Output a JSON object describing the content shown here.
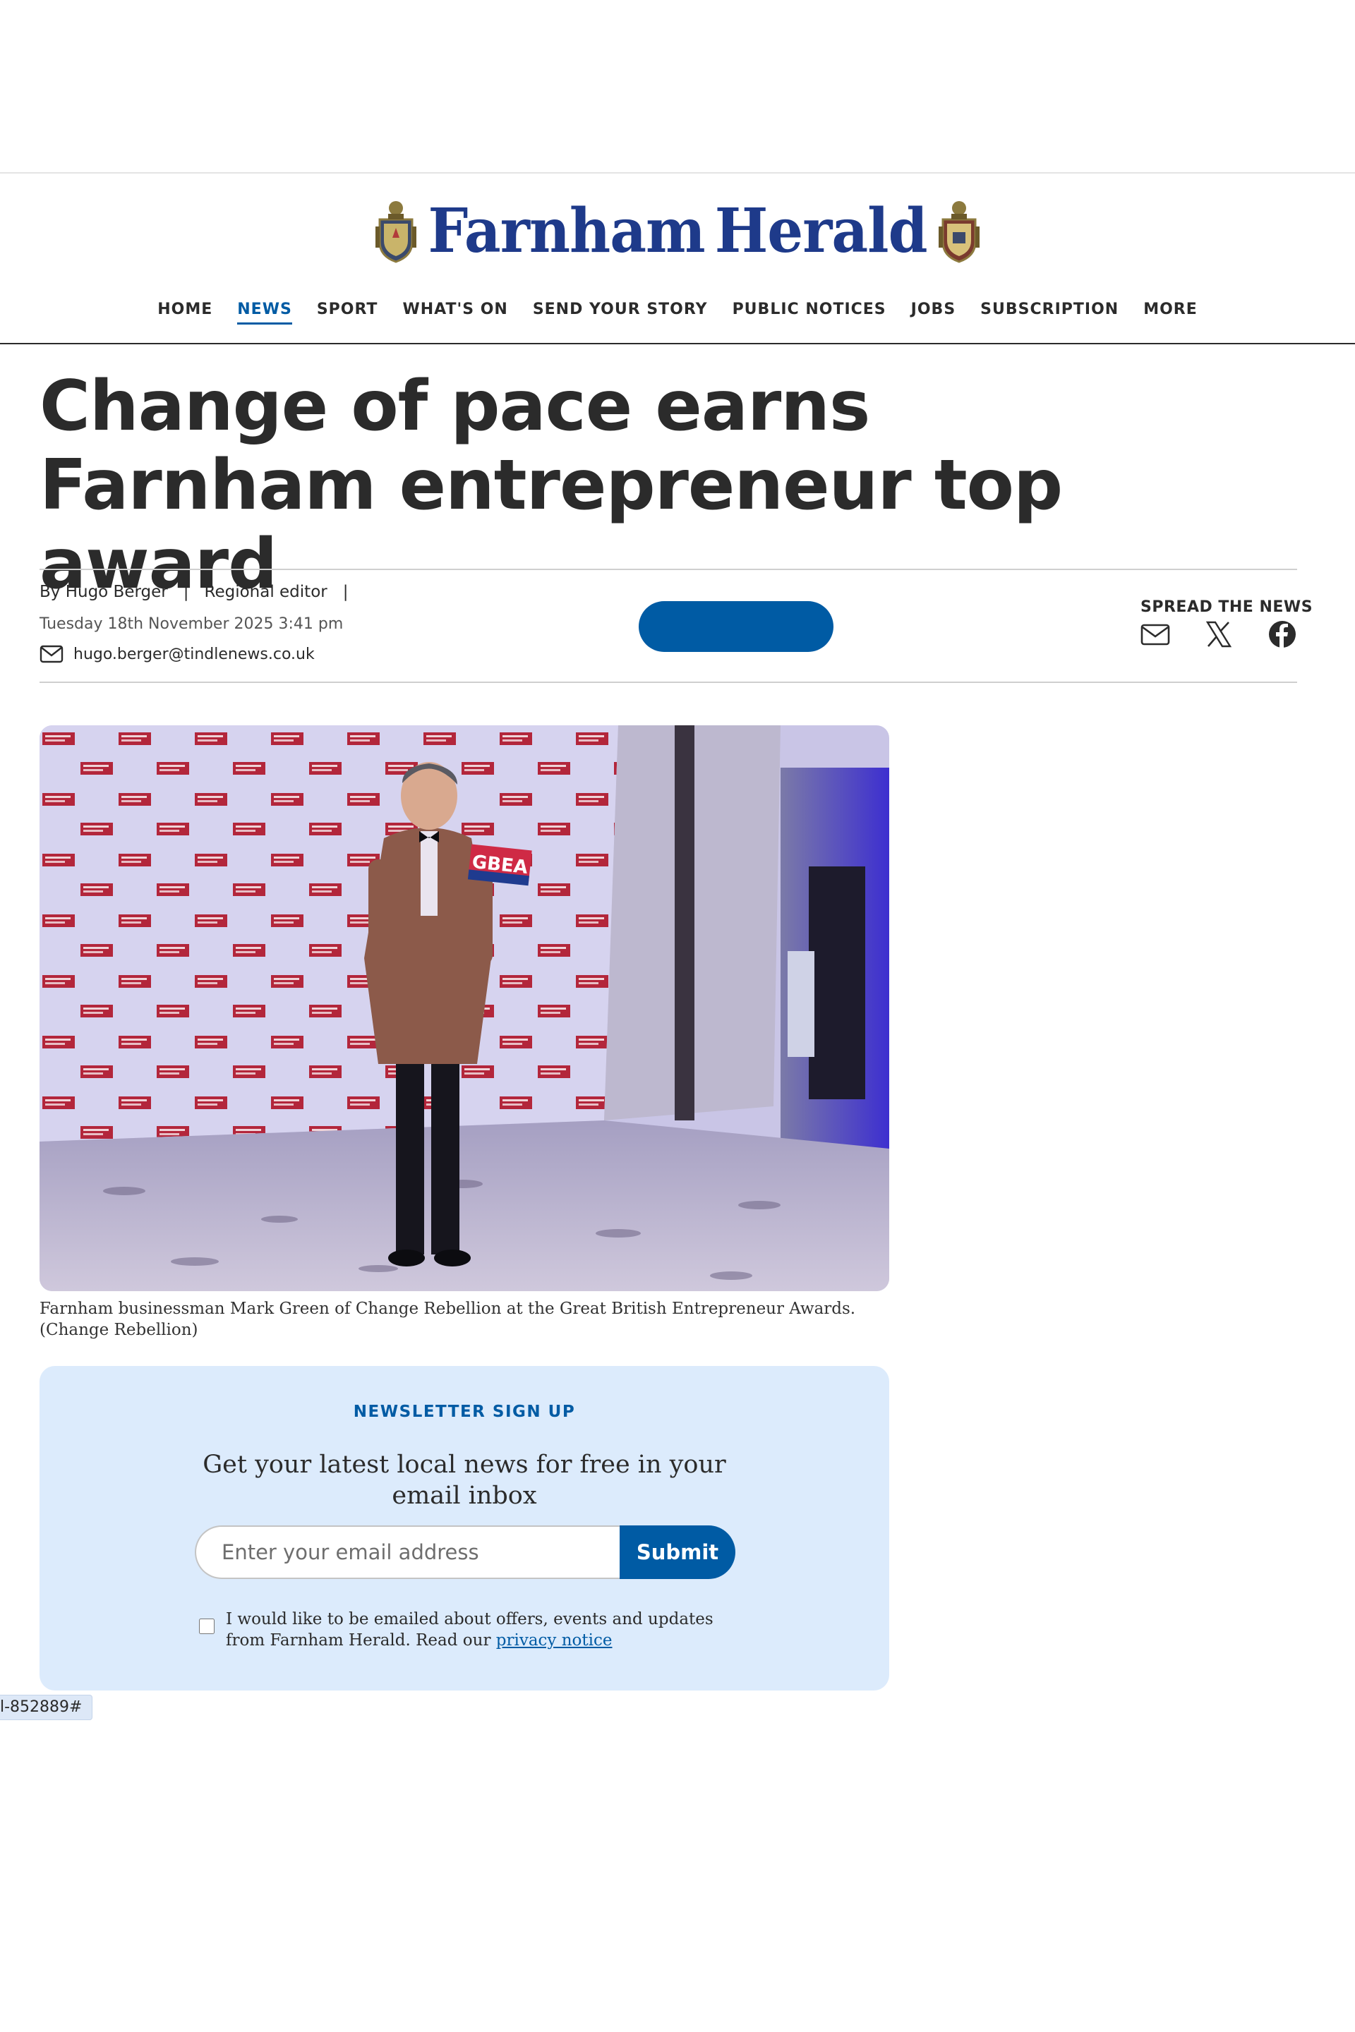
{
  "site": {
    "logo_left": "Farnham",
    "logo_right": "Herald",
    "brand_color": "#1e3a8a",
    "accent_color": "#005ba4"
  },
  "nav": {
    "items": [
      {
        "label": "HOME",
        "active": false
      },
      {
        "label": "NEWS",
        "active": true
      },
      {
        "label": "SPORT",
        "active": false
      },
      {
        "label": "WHAT'S ON",
        "active": false
      },
      {
        "label": "SEND YOUR STORY",
        "active": false
      },
      {
        "label": "PUBLIC NOTICES",
        "active": false
      },
      {
        "label": "JOBS",
        "active": false
      },
      {
        "label": "SUBSCRIPTION",
        "active": false
      },
      {
        "label": "MORE",
        "active": false
      }
    ]
  },
  "article": {
    "headline": "Change of pace earns Farnham entrepreneur top award",
    "byline": "By Hugo Berger",
    "role": "Regional editor",
    "separator": "|",
    "date": "Tuesday 18th November 2025 3:41 pm",
    "email": "hugo.berger@tindlenews.co.uk",
    "share_label": "SPREAD THE NEWS",
    "share_icons": [
      "email-icon",
      "x-icon",
      "facebook-icon"
    ],
    "image_badge": "GBEA",
    "caption": "Farnham businessman Mark Green of Change Rebellion at the Great British Entrepreneur Awards. (Change Rebellion)"
  },
  "newsletter": {
    "title": "NEWSLETTER SIGN UP",
    "text": "Get your latest local news for free in your email inbox",
    "input_placeholder": "Enter your email address",
    "submit_label": "Submit",
    "consent_text": "I would like to be emailed about offers, events and updates from Farnham Herald. Read our ",
    "privacy_link": "privacy notice",
    "background": "#dcebfc"
  },
  "status_url": "l-852889#"
}
